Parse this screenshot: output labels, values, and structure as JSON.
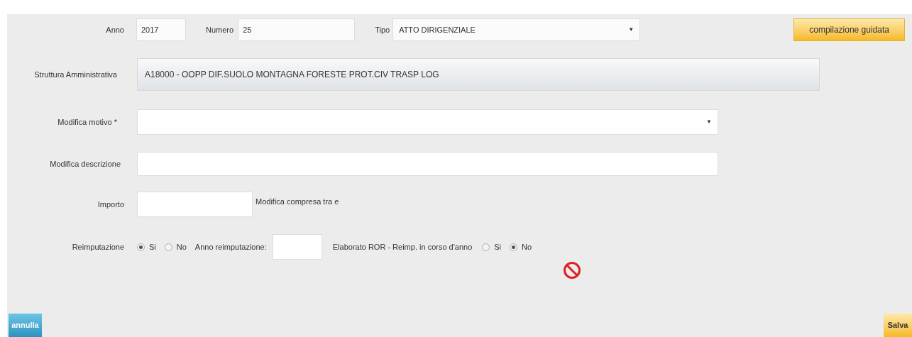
{
  "form": {
    "anno": {
      "label": "Anno",
      "value": "2017"
    },
    "numero": {
      "label": "Numero",
      "value": "25"
    },
    "tipo": {
      "label": "Tipo",
      "value": "ATTO DIRIGENZIALE",
      "arrow": "▼"
    },
    "guided_button": "compilazione guidata",
    "struttura": {
      "label": "Struttura Amministrativa",
      "value": "A18000 - OOPP DIF.SUOLO MONTAGNA FORESTE PROT.CIV TRASP LOG"
    },
    "modifica_motivo": {
      "label": "Modifica motivo *",
      "arrow": "▼"
    },
    "modifica_descrizione": {
      "label": "Modifica descrizione"
    },
    "importo": {
      "label": "Importo",
      "note": "Modifica compresa tra e"
    },
    "reimputazione": {
      "label": "Reimputazione",
      "options": [
        {
          "label": "Si",
          "selected": true
        },
        {
          "label": "No",
          "selected": false
        }
      ]
    },
    "anno_reimputazione": {
      "label": "Anno reimputazione:"
    },
    "elaborato": {
      "label": "Elaborato ROR - Reimp. in corso d'anno",
      "options": [
        {
          "label": "Si",
          "selected": false
        },
        {
          "label": "No",
          "selected": true
        }
      ]
    }
  },
  "buttons": {
    "cancel": "annulla",
    "save": "Salva"
  }
}
